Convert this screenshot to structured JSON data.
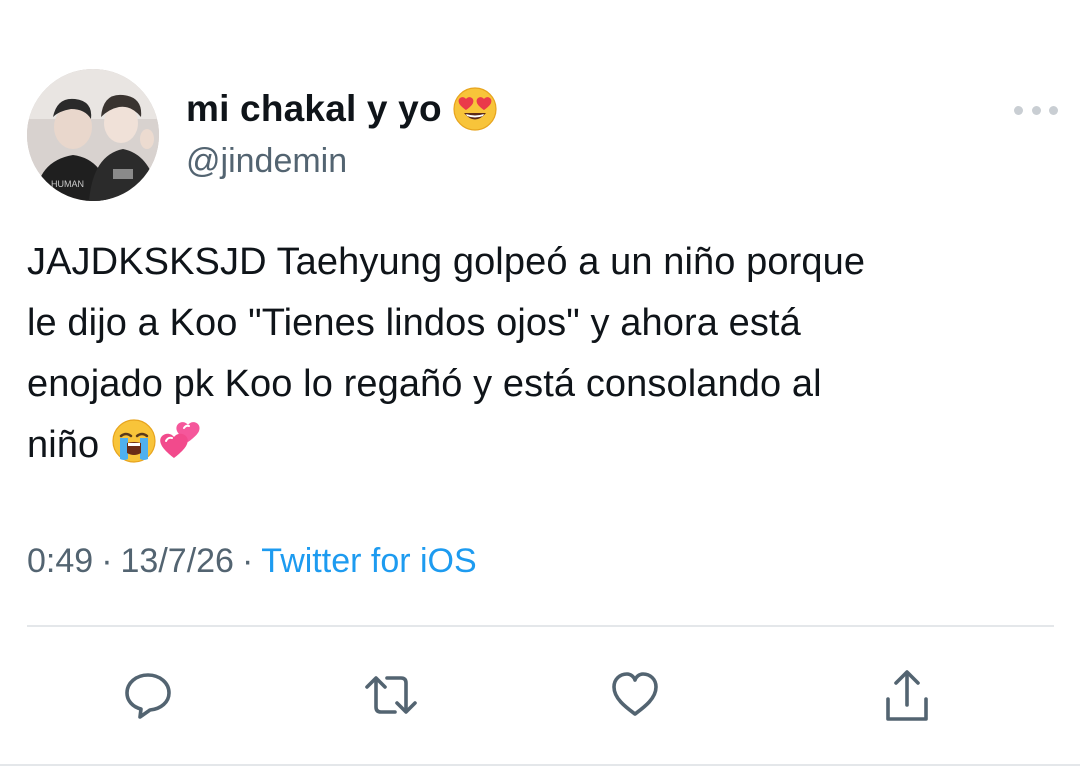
{
  "author": {
    "display_name": "mi chakal y yo",
    "name_emoji": "smiling-face-with-heart-eyes",
    "handle": "@jindemin",
    "avatar": "profile-photo"
  },
  "tweet": {
    "lines": [
      "JAJDKSKSJD Taehyung golpeó a un niño porque",
      "le dijo a Koo \"Tienes lindos ojos\" y ahora está",
      "enojado pk Koo lo regañó y está consolando al",
      "niño"
    ],
    "trailing_emojis": [
      "loudly-crying-face",
      "two-hearts"
    ]
  },
  "meta": {
    "time": "0:49",
    "separator": "·",
    "date": "13/7/26",
    "source": "Twitter for iOS"
  },
  "actions": {
    "reply_icon": "speech-bubble-icon",
    "retweet_icon": "retweet-icon",
    "like_icon": "heart-icon",
    "share_icon": "share-icon"
  },
  "colors": {
    "text": "#0f1419",
    "secondary": "#536471",
    "link": "#1d9bf0",
    "icon": "#536471",
    "divider": "#e4e7ea"
  }
}
